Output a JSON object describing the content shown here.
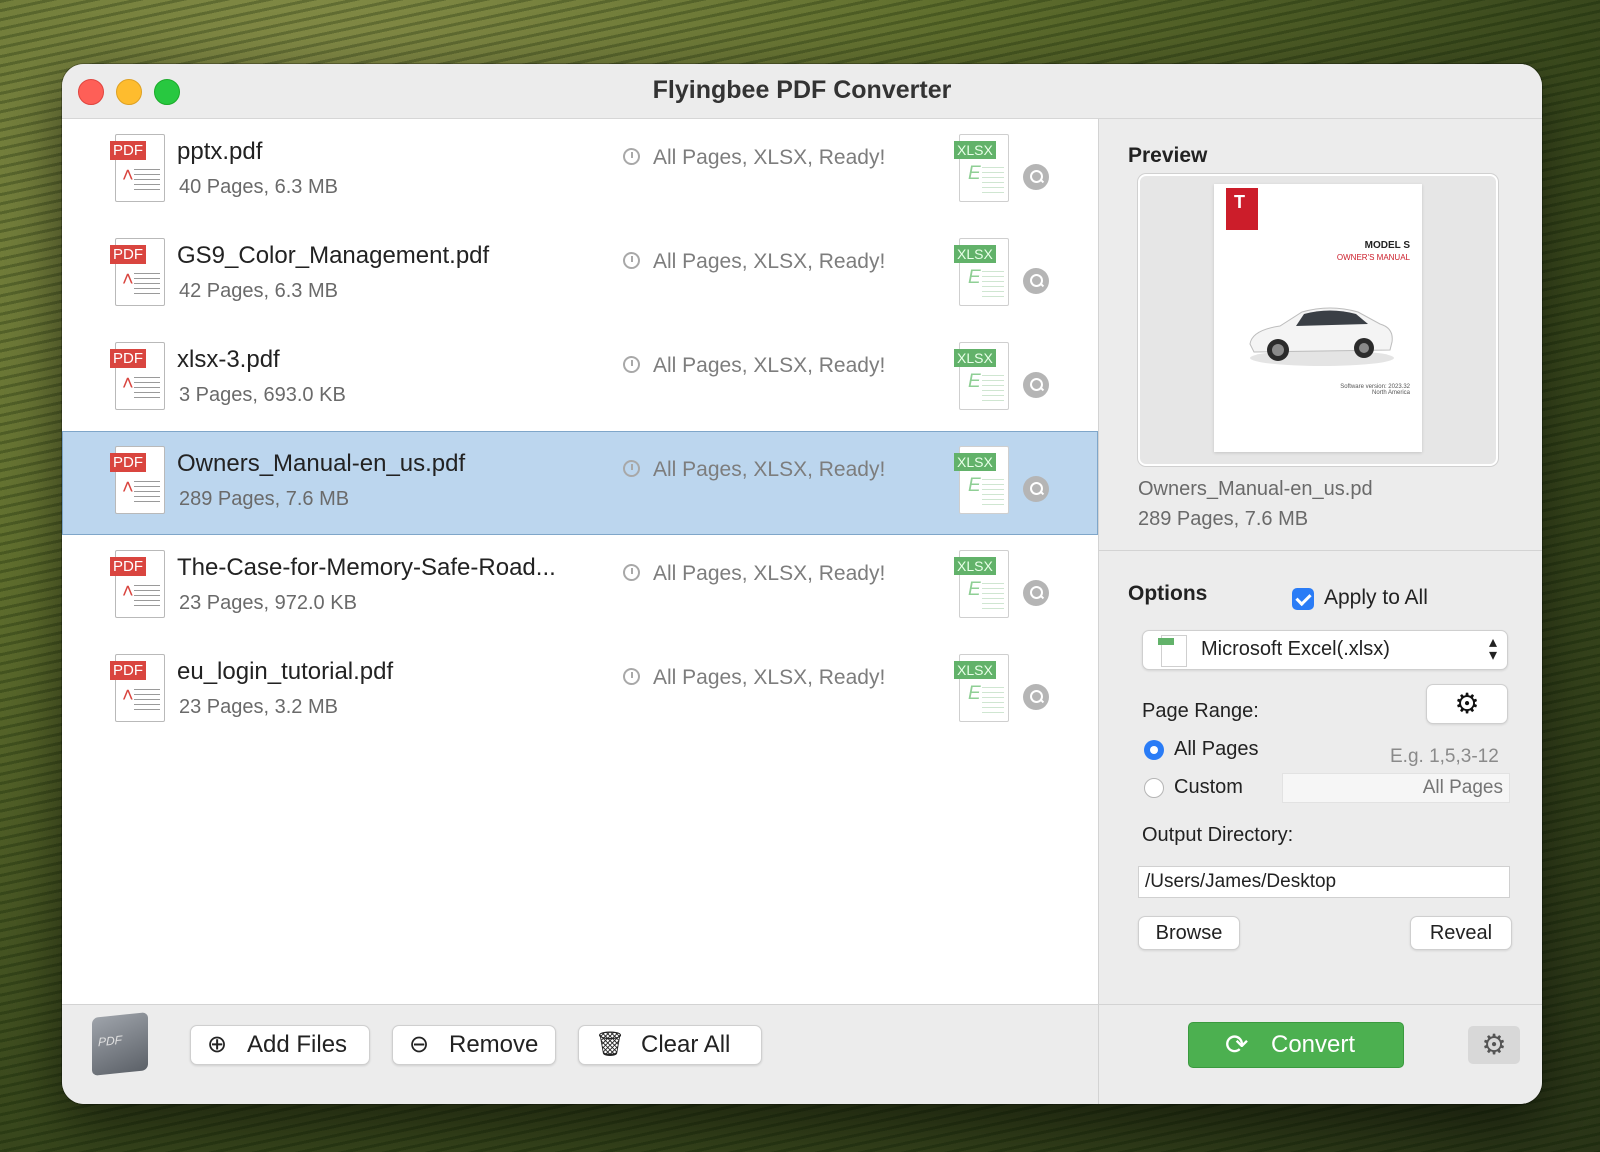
{
  "window": {
    "title": "Flyingbee PDF Converter"
  },
  "files": [
    {
      "name": "pptx.pdf",
      "meta": "40 Pages, 6.3 MB",
      "status": "All Pages, XLSX, Ready!",
      "selected": false
    },
    {
      "name": "GS9_Color_Management.pdf",
      "meta": "42 Pages, 6.3 MB",
      "status": "All Pages, XLSX, Ready!",
      "selected": false
    },
    {
      "name": "xlsx-3.pdf",
      "meta": "3 Pages, 693.0 KB",
      "status": "All Pages, XLSX, Ready!",
      "selected": false
    },
    {
      "name": "Owners_Manual-en_us.pdf",
      "meta": "289 Pages, 7.6 MB",
      "status": "All Pages, XLSX, Ready!",
      "selected": true
    },
    {
      "name": "The-Case-for-Memory-Safe-Road...",
      "meta": "23 Pages, 972.0 KB",
      "status": "All Pages, XLSX, Ready!",
      "selected": false
    },
    {
      "name": "eu_login_tutorial.pdf",
      "meta": "23 Pages, 3.2 MB",
      "status": "All Pages, XLSX, Ready!",
      "selected": false
    }
  ],
  "file_icon_labels": {
    "pdf": "PDF",
    "xlsx": "XLSX",
    "xlsx_letter": "E"
  },
  "preview": {
    "heading": "Preview",
    "doc_title": "MODEL S",
    "doc_subtitle": "OWNER'S MANUAL",
    "doc_version": "Software version: 2023.32",
    "doc_region": "North America",
    "file_name": "Owners_Manual-en_us.pd",
    "file_meta": "289 Pages, 7.6 MB"
  },
  "options": {
    "heading": "Options",
    "apply_to_all_label": "Apply to All",
    "apply_to_all_checked": true,
    "format": "Microsoft Excel(.xlsx)",
    "page_range_label": "Page Range:",
    "all_pages_label": "All Pages",
    "custom_label": "Custom",
    "selected_range": "All Pages",
    "range_example": "E.g. 1,5,3-12",
    "custom_placeholder": "All Pages",
    "output_dir_label": "Output Directory:",
    "output_dir_value": "/Users/James/Desktop",
    "browse_label": "Browse",
    "reveal_label": "Reveal"
  },
  "toolbar": {
    "add_files_label": "Add Files",
    "remove_label": "Remove",
    "clear_all_label": "Clear All",
    "convert_label": "Convert"
  },
  "icons": {
    "gear": "⚙",
    "refresh": "⟳",
    "add_file": "⊕",
    "remove_file": "⊖",
    "trash": "🗑",
    "chevron_updown": "⌃⌄"
  },
  "colors": {
    "selection": "#bcd6ee",
    "accent_blue": "#2a7cf6",
    "convert_green": "#4cb050",
    "pdf_red": "#d9453f",
    "xlsx_green": "#62b26a"
  }
}
